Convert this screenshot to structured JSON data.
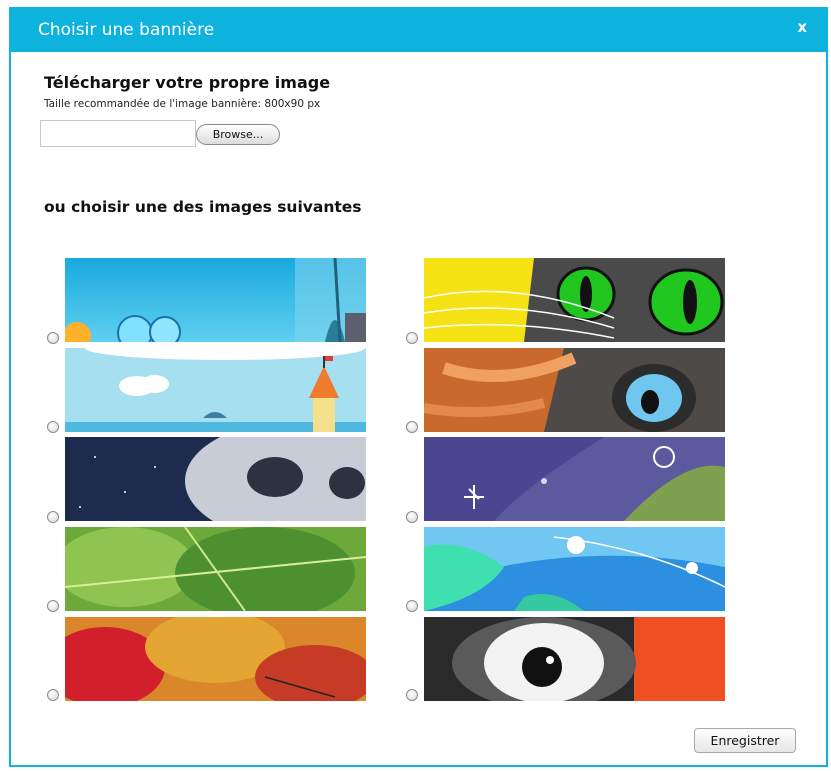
{
  "dialog": {
    "title": "Choisir une bannière",
    "close_label": "x"
  },
  "upload": {
    "heading": "Télécharger votre propre image",
    "hint": "Taille recommandée de l'image bannière: 800x90 px",
    "file_value": "",
    "browse_label": "Browse..."
  },
  "choose": {
    "heading": "ou choisir une des images suivantes"
  },
  "banners": [
    {
      "name": "underwater",
      "selected": false
    },
    {
      "name": "cat-eyes",
      "selected": false
    },
    {
      "name": "sky-castle",
      "selected": false
    },
    {
      "name": "animal-eye",
      "selected": false
    },
    {
      "name": "space-creature",
      "selected": false
    },
    {
      "name": "snowflake-space",
      "selected": false
    },
    {
      "name": "green-leaves",
      "selected": false
    },
    {
      "name": "earth-globe",
      "selected": false
    },
    {
      "name": "autumn-leaves",
      "selected": false
    },
    {
      "name": "cartoon-eye",
      "selected": false
    }
  ],
  "footer": {
    "save_label": "Enregistrer"
  },
  "colors": {
    "accent": "#0db2dd"
  }
}
